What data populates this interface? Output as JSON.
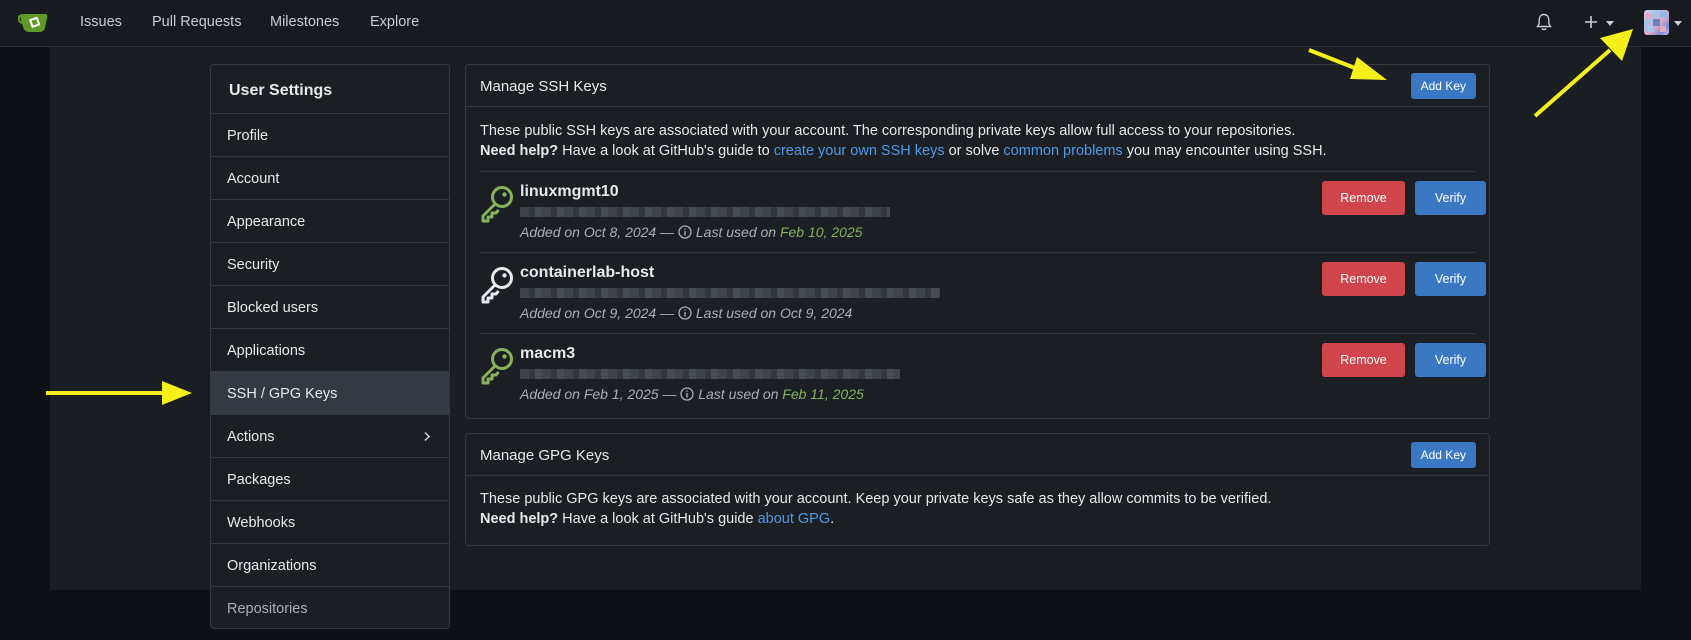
{
  "nav": {
    "items": [
      "Issues",
      "Pull Requests",
      "Milestones",
      "Explore"
    ],
    "icons": [
      "bell-icon",
      "plus-icon",
      "avatar"
    ]
  },
  "sidebar": {
    "title": "User Settings",
    "items": [
      {
        "label": "Profile"
      },
      {
        "label": "Account"
      },
      {
        "label": "Appearance"
      },
      {
        "label": "Security"
      },
      {
        "label": "Blocked users"
      },
      {
        "label": "Applications"
      },
      {
        "label": "SSH / GPG Keys",
        "active": true
      },
      {
        "label": "Actions"
      },
      {
        "label": "Packages"
      },
      {
        "label": "Webhooks"
      },
      {
        "label": "Organizations"
      },
      {
        "label": "Repositories"
      }
    ]
  },
  "ssh": {
    "title": "Manage SSH Keys",
    "add_label": "Add Key",
    "desc_line1": "These public SSH keys are associated with your account. The corresponding private keys allow full access to your repositories.",
    "help_bold": "Need help?",
    "help_pre": " Have a look at GitHub's guide to ",
    "help_link1": "create your own SSH keys",
    "help_mid": " or solve ",
    "help_link2": "common problems",
    "help_post": " you may encounter using SSH.",
    "remove_label": "Remove",
    "verify_label": "Verify",
    "keys": [
      {
        "name": "linuxmgmt10",
        "added": "Added on Oct 8, 2024 — ",
        "last_used_prefix": "Last used on ",
        "last_used": "Feb 10, 2025",
        "recent": true
      },
      {
        "name": "containerlab-host",
        "added": "Added on Oct 9, 2024 — ",
        "last_used_prefix": "Last used on ",
        "last_used": "Oct 9, 2024",
        "recent": false
      },
      {
        "name": "macm3",
        "added": "Added on Feb 1, 2025 — ",
        "last_used_prefix": "Last used on ",
        "last_used": "Feb 11, 2025",
        "recent": true
      }
    ]
  },
  "gpg": {
    "title": "Manage GPG Keys",
    "add_label": "Add Key",
    "desc_line1": "These public GPG keys are associated with your account. Keep your private keys safe as they allow commits to be verified.",
    "help_bold": "Need help?",
    "help_pre": " Have a look at GitHub's guide ",
    "help_link": "about GPG",
    "help_post": "."
  },
  "colors": {
    "accent": "#3b78c4",
    "danger": "#d0454c",
    "recent_green": "#86b35a",
    "link": "#4c9be8",
    "annotation_arrow": "#f5f01a"
  }
}
